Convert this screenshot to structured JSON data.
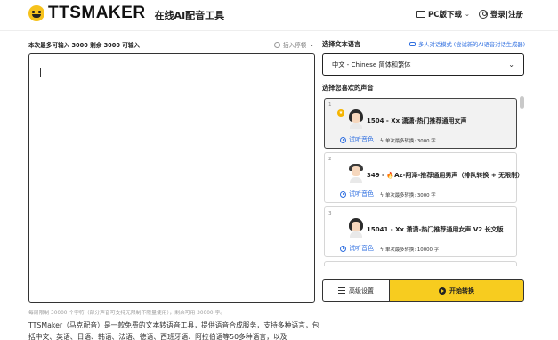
{
  "header": {
    "brand": "TTSMAKER",
    "subtitle": "在线AI配音工具",
    "pc_download": "PC版下载",
    "login_register": "登录|注册"
  },
  "editor": {
    "limits": "本次最多可输入 3000 剩余 3000 可输入",
    "insert_pause": "插入停顿",
    "text_value": "",
    "footnote": "每周限制 30000 个字符（部分声音可支持无限制不限量使用），剩余可用 30000 字。",
    "description": "TTSMaker（马克配音）是一款免费的文本转语音工具，提供语音合成服务，支持多种语言，包括中文、英语、日语、韩语、法语、德语、西班牙语、阿拉伯语等50多种语言，以及"
  },
  "language": {
    "label": "选择文本语言",
    "multi_voice_link": "多人对话模式 (尝试新的AI语音对话生成器)",
    "selected": "中文 - Chinese 简体和繁体"
  },
  "voices": {
    "label": "选择您喜欢的声音",
    "preview_label": "试听音色",
    "items": [
      {
        "num": "1",
        "title": "1504 - Xx 潇潇-热门推荐通用女声",
        "max": "单次最多转换: 3000 字",
        "badge": "★",
        "gender": "female"
      },
      {
        "num": "2",
        "title": "349 - 🔥Az-阿泽-推荐通用男声（排队转换 + 无限制）",
        "max": "单次最多转换: 3000 字",
        "badge": "",
        "gender": "male"
      },
      {
        "num": "3",
        "title": "15041 - Xx 潇潇-热门推荐通用女声 V2 长文版",
        "max": "单次最多转换: 10000 字",
        "badge": "",
        "gender": "female"
      }
    ]
  },
  "actions": {
    "advanced_settings": "高级设置",
    "start_convert": "开始转换"
  },
  "colors": {
    "accent_yellow": "#f7cc1f",
    "link_blue": "#2f6fe0"
  }
}
